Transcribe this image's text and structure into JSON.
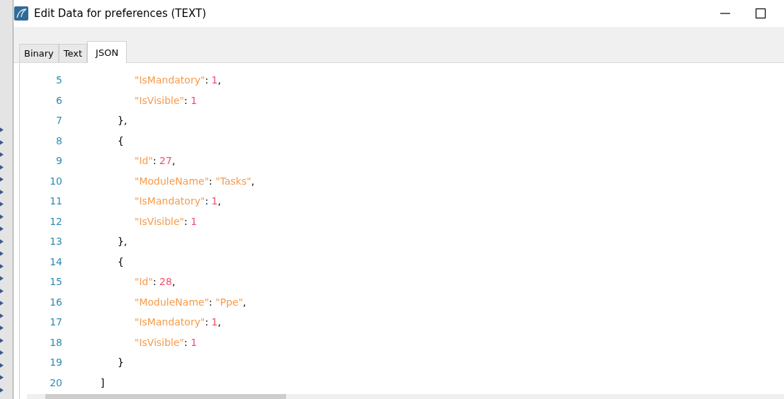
{
  "window": {
    "title": "Edit Data for preferences (TEXT)"
  },
  "tabs": [
    {
      "label": "Binary",
      "selected": false
    },
    {
      "label": "Text",
      "selected": false
    },
    {
      "label": "JSON",
      "selected": true
    }
  ],
  "editor": {
    "lines": [
      {
        "children": [
          {
            "children": [
              {
                "number": "5",
                "tokens": [
                  {
                    "kind": "key",
                    "text": "\"IsMandatory\""
                  },
                  {
                    "kind": "punct",
                    "text": ": "
                  },
                  {
                    "kind": "number",
                    "text": "1"
                  },
                  {
                    "kind": "punct",
                    "text": ","
                  }
                ]
              },
              {
                "number": "6",
                "tokens": [
                  {
                    "kind": "key",
                    "text": "\"IsVisible\""
                  },
                  {
                    "kind": "punct",
                    "text": ": "
                  },
                  {
                    "kind": "number",
                    "text": "1"
                  }
                ]
              }
            ]
          },
          {
            "number": "7",
            "tokens": [
              {
                "kind": "punct",
                "text": "},"
              }
            ]
          },
          {
            "number": "8",
            "tokens": [
              {
                "kind": "punct",
                "text": "{"
              }
            ]
          },
          {
            "children": [
              {
                "number": "9",
                "tokens": [
                  {
                    "kind": "key",
                    "text": "\"Id\""
                  },
                  {
                    "kind": "punct",
                    "text": ": "
                  },
                  {
                    "kind": "number",
                    "text": "27"
                  },
                  {
                    "kind": "punct",
                    "text": ","
                  }
                ]
              },
              {
                "number": "10",
                "tokens": [
                  {
                    "kind": "key",
                    "text": "\"ModuleName\""
                  },
                  {
                    "kind": "punct",
                    "text": ": "
                  },
                  {
                    "kind": "string",
                    "text": "\"Tasks\""
                  },
                  {
                    "kind": "punct",
                    "text": ","
                  }
                ]
              },
              {
                "number": "11",
                "tokens": [
                  {
                    "kind": "key",
                    "text": "\"IsMandatory\""
                  },
                  {
                    "kind": "punct",
                    "text": ": "
                  },
                  {
                    "kind": "number",
                    "text": "1"
                  },
                  {
                    "kind": "punct",
                    "text": ","
                  }
                ]
              },
              {
                "number": "12",
                "tokens": [
                  {
                    "kind": "key",
                    "text": "\"IsVisible\""
                  },
                  {
                    "kind": "punct",
                    "text": ": "
                  },
                  {
                    "kind": "number",
                    "text": "1"
                  }
                ]
              }
            ]
          },
          {
            "number": "13",
            "tokens": [
              {
                "kind": "punct",
                "text": "},"
              }
            ]
          },
          {
            "number": "14",
            "tokens": [
              {
                "kind": "punct",
                "text": "{"
              }
            ]
          },
          {
            "children": [
              {
                "number": "15",
                "tokens": [
                  {
                    "kind": "key",
                    "text": "\"Id\""
                  },
                  {
                    "kind": "punct",
                    "text": ": "
                  },
                  {
                    "kind": "number",
                    "text": "28"
                  },
                  {
                    "kind": "punct",
                    "text": ","
                  }
                ]
              },
              {
                "number": "16",
                "tokens": [
                  {
                    "kind": "key",
                    "text": "\"ModuleName\""
                  },
                  {
                    "kind": "punct",
                    "text": ": "
                  },
                  {
                    "kind": "string",
                    "text": "\"Ppe\""
                  },
                  {
                    "kind": "punct",
                    "text": ","
                  }
                ]
              },
              {
                "number": "17",
                "tokens": [
                  {
                    "kind": "key",
                    "text": "\"IsMandatory\""
                  },
                  {
                    "kind": "punct",
                    "text": ": "
                  },
                  {
                    "kind": "number",
                    "text": "1"
                  },
                  {
                    "kind": "punct",
                    "text": ","
                  }
                ]
              },
              {
                "number": "18",
                "tokens": [
                  {
                    "kind": "key",
                    "text": "\"IsVisible\""
                  },
                  {
                    "kind": "punct",
                    "text": ": "
                  },
                  {
                    "kind": "number",
                    "text": "1"
                  }
                ]
              }
            ]
          },
          {
            "number": "19",
            "tokens": [
              {
                "kind": "punct",
                "text": "}"
              }
            ]
          }
        ]
      },
      {
        "number": "20",
        "tokens": [
          {
            "kind": "punct",
            "text": "]"
          }
        ]
      }
    ]
  }
}
